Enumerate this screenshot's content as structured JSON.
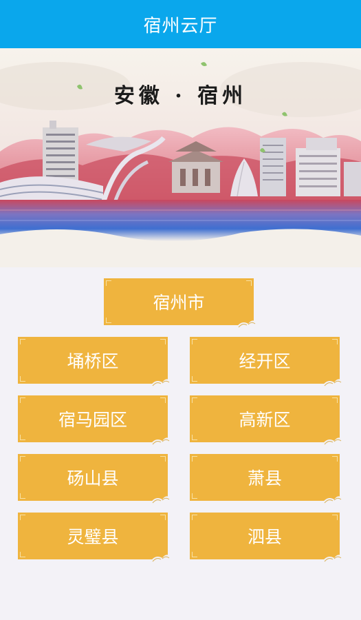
{
  "header": {
    "title": "宿州云厅"
  },
  "banner": {
    "title": "安徽 · 宿州"
  },
  "city": {
    "label": "宿州市"
  },
  "districts": [
    {
      "label": "埇桥区"
    },
    {
      "label": "经开区"
    },
    {
      "label": "宿马园区"
    },
    {
      "label": "高新区"
    },
    {
      "label": "砀山县"
    },
    {
      "label": "萧县"
    },
    {
      "label": "灵璧县"
    },
    {
      "label": "泗县"
    }
  ],
  "colors": {
    "header": "#0aa7ec",
    "tile": "#efb43e",
    "background": "#f3f2f7"
  }
}
